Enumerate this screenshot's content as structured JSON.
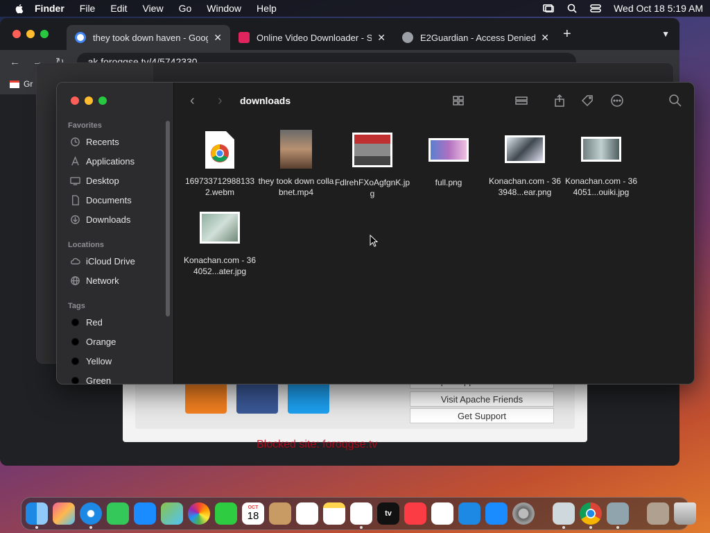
{
  "menubar": {
    "app": "Finder",
    "items": [
      "File",
      "Edit",
      "View",
      "Go",
      "Window",
      "Help"
    ],
    "datetime": "Wed Oct 18  5:19 AM"
  },
  "browser": {
    "tabs": [
      {
        "title": "they took down haven - Google",
        "color": "#4285f4"
      },
      {
        "title": "Online Video Downloader - SS",
        "color": "#e0245e"
      },
      {
        "title": "E2Guardian - Access Denied",
        "color": "#9aa0a6"
      }
    ],
    "url": "ak.foroqgse.tv/4/5742330",
    "bookmark": "Gr",
    "page_buttons": [
      "Open Application Folder",
      "Visit Apache Friends",
      "Get Support"
    ],
    "blocked_text": "Blocked site: foroqgse.tv"
  },
  "finder": {
    "title": "downloads",
    "sections": {
      "favorites": "Favorites",
      "locations": "Locations",
      "tags": "Tags"
    },
    "favorites": [
      "Recents",
      "Applications",
      "Desktop",
      "Documents",
      "Downloads"
    ],
    "locations": [
      "iCloud Drive",
      "Network"
    ],
    "tags": [
      "Red",
      "Orange",
      "Yellow",
      "Green"
    ],
    "files": [
      {
        "name": "1697337129881332.webm",
        "kind": "chrome"
      },
      {
        "name": "they took down collabnet.mp4",
        "kind": "video"
      },
      {
        "name": "FdlrehFXoAgfgnK.jpg",
        "kind": "car"
      },
      {
        "name": "full.png",
        "kind": "poster"
      },
      {
        "name": "Konachan.com - 363948...ear.png",
        "kind": "anime1"
      },
      {
        "name": "Konachan.com - 364051...ouiki.jpg",
        "kind": "anime2"
      },
      {
        "name": "Konachan.com - 364052...ater.jpg",
        "kind": "anime3"
      }
    ]
  },
  "dock": {
    "calendar_month": "OCT",
    "calendar_day": "18",
    "tv_label": "tv"
  }
}
